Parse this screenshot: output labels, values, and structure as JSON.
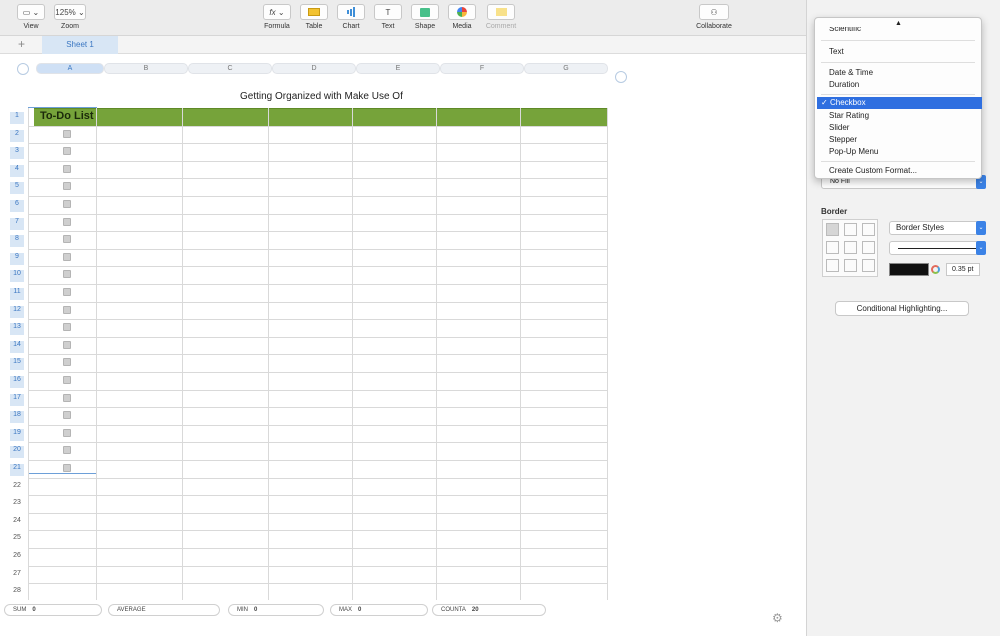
{
  "toolbar": {
    "view_label": "View",
    "zoom_value": "125%",
    "zoom_label": "Zoom",
    "formula_icon": "fx",
    "formula_label": "Formula",
    "table_label": "Table",
    "chart_label": "Chart",
    "text_icon": "T",
    "text_label": "Text",
    "shape_label": "Shape",
    "media_label": "Media",
    "comment_label": "Comment",
    "collaborate_label": "Collaborate"
  },
  "tabs": {
    "add_icon": "+",
    "sheet1": "Sheet 1"
  },
  "sheet": {
    "title": "Getting Organized with Make Use Of",
    "header_cell": "To-Do List",
    "columns": [
      "A",
      "B",
      "C",
      "D",
      "E",
      "F",
      "G"
    ],
    "rows": [
      "1",
      "2",
      "3",
      "4",
      "5",
      "6",
      "7",
      "8",
      "9",
      "10",
      "11",
      "12",
      "13",
      "14",
      "15",
      "16",
      "17",
      "18",
      "19",
      "20",
      "21",
      "22",
      "23",
      "24",
      "25",
      "26",
      "27",
      "28"
    ]
  },
  "status": {
    "sum_label": "SUM",
    "sum_value": "0",
    "average_label": "AVERAGE",
    "min_label": "MIN",
    "min_value": "0",
    "max_label": "MAX",
    "max_value": "0",
    "counta_label": "COUNTA",
    "counta_value": "20"
  },
  "format_menu": {
    "up_arrow": "▲",
    "partial_item": "Scientific",
    "items": {
      "text": "Text",
      "date_time": "Date & Time",
      "duration": "Duration",
      "checkbox": "Checkbox",
      "star_rating": "Star Rating",
      "slider": "Slider",
      "stepper": "Stepper",
      "popup": "Pop-Up Menu",
      "custom": "Create Custom Format..."
    },
    "check_mark": "✓"
  },
  "panel": {
    "fill_value": "No Fill",
    "border_title": "Border",
    "border_styles": "Border Styles",
    "border_width": "0.35 pt",
    "border_color": "#111111",
    "conditional_button": "Conditional Highlighting..."
  },
  "colors": {
    "accent": "#3b77c2",
    "header_green": "#76a33a",
    "menu_highlight": "#2f6fe0"
  }
}
